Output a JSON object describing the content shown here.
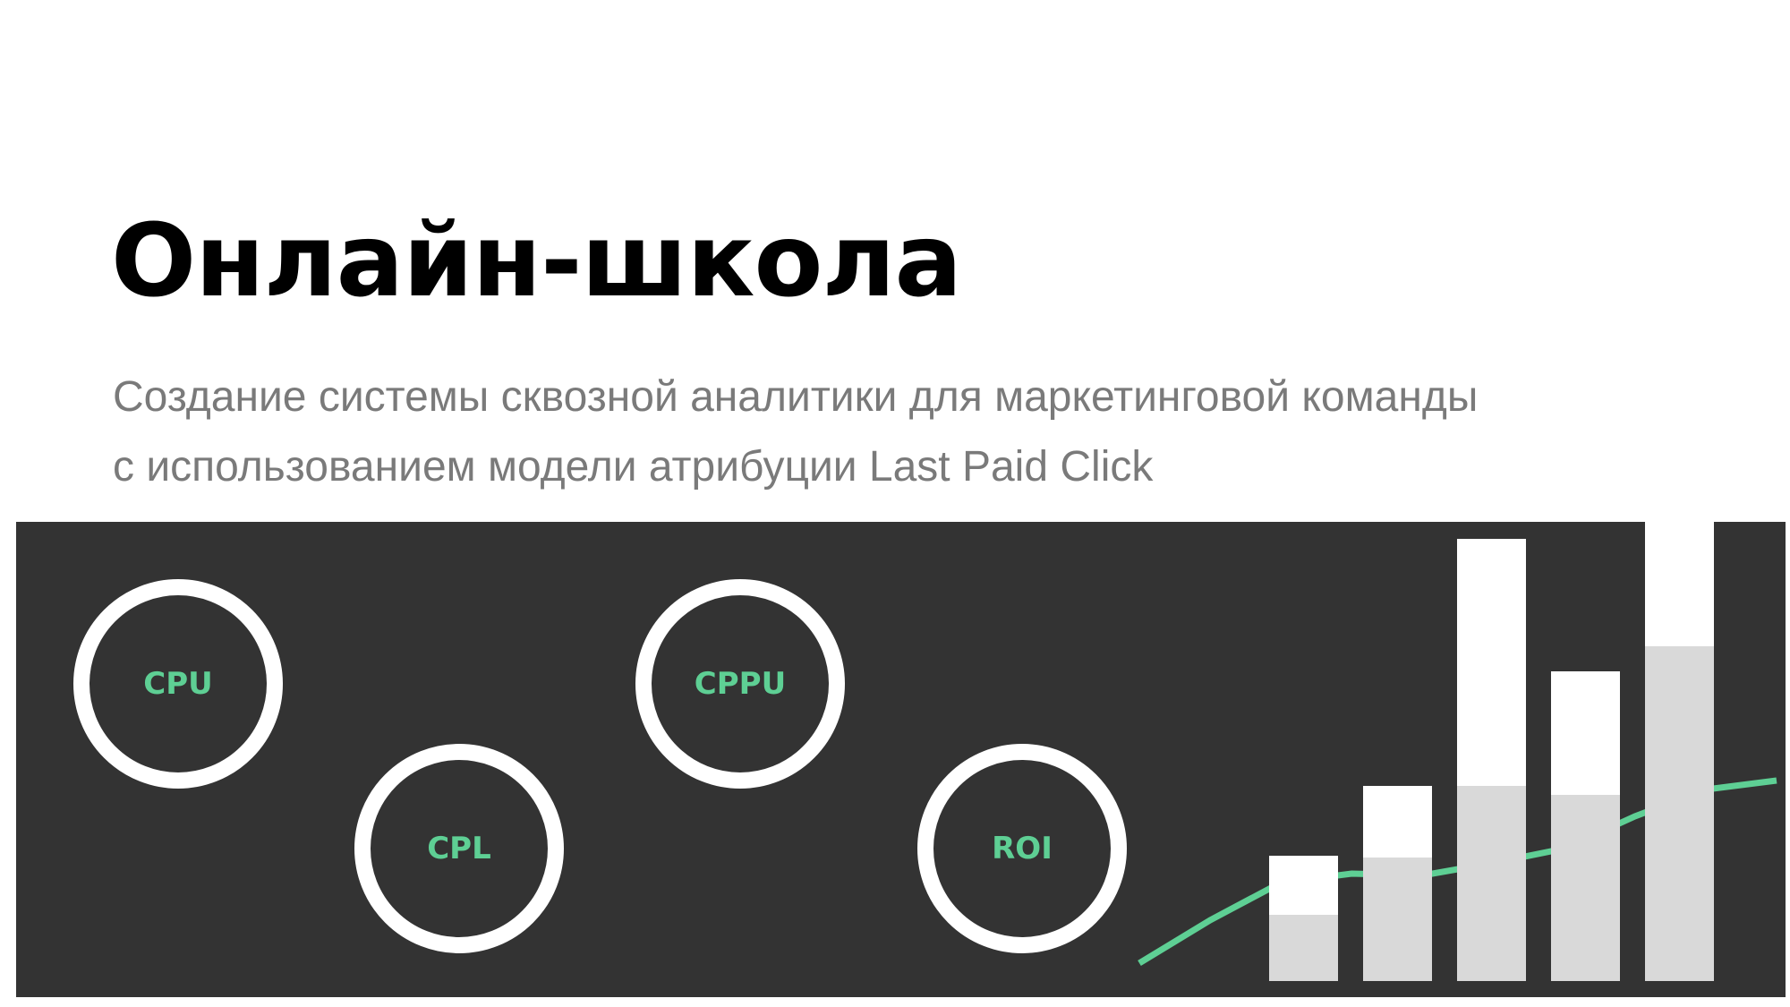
{
  "slide": {
    "title": "Онлайн-школа",
    "subtitle_lines": [
      "Создание системы сквозной аналитики для маркетинговой команды",
      "с использованием модели атрибуции Last Paid Click"
    ]
  },
  "metrics": [
    "CPU",
    "CPL",
    "CPPU",
    "ROI"
  ],
  "colors": {
    "banner_bg": "#333333",
    "accent_green": "#5ecf94",
    "circle_stroke": "#ffffff",
    "bar_top": "#ffffff",
    "bar_bottom": "#d9d9d9",
    "title": "#000000",
    "subtitle": "#7a7a7a"
  },
  "chart_data": {
    "type": "bar",
    "categories": [
      "",
      "",
      "",
      "",
      ""
    ],
    "series": [
      {
        "values": [
          37,
          69,
          109,
          104,
          187
        ]
      },
      {
        "values": [
          33,
          40,
          138,
          69,
          94
        ]
      }
    ],
    "line": [
      10,
      34,
      55,
      60,
      59,
      66,
      74,
      92,
      107,
      112
    ],
    "ylim": [
      0,
      250
    ],
    "grid": false
  }
}
